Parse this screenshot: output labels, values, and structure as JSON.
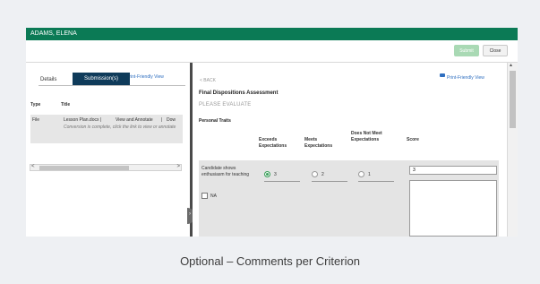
{
  "window": {
    "title": "ADAMS, ELENA"
  },
  "toolbar": {
    "submit_label": "Submit",
    "close_label": "Close"
  },
  "left_pane": {
    "print_label": "Print-Friendly View",
    "tabs": [
      "Details",
      "Submission(s)"
    ],
    "table": {
      "headers": [
        "Type",
        "Title"
      ],
      "row": {
        "type": "File",
        "title": "Lesson Plan.docx |",
        "link1": "View and Annotate",
        "sep": "|",
        "link2": "Dow",
        "note": "Conversion is complete, click the link to view or annotate"
      }
    },
    "scroll_left": "<",
    "scroll_right": ">"
  },
  "right_pane": {
    "back_label": "< BACK",
    "print_label": "Print-Friendly View",
    "assessment_title": "Final Dispositions Assessment",
    "evaluate_label": "PLEASE EVALUATE",
    "section_title": "Personal Traits",
    "columns": [
      "Exceeds Expectations",
      "Meets Expectations",
      "Does Not Meet Expectations",
      "Score"
    ],
    "criterion": {
      "text": "Candidate shows enthusiasm for teaching",
      "na_label": "NA",
      "options": [
        "3",
        "2",
        "1"
      ],
      "selected_option": "3",
      "score_value": "3"
    }
  },
  "caption": "Optional – Comments per Criterion",
  "colors": {
    "header_green": "#0b7a55",
    "tab_navy": "#0f3b5a",
    "link_blue": "#2f6fc0",
    "submit_disabled": "#a9d9b4"
  }
}
